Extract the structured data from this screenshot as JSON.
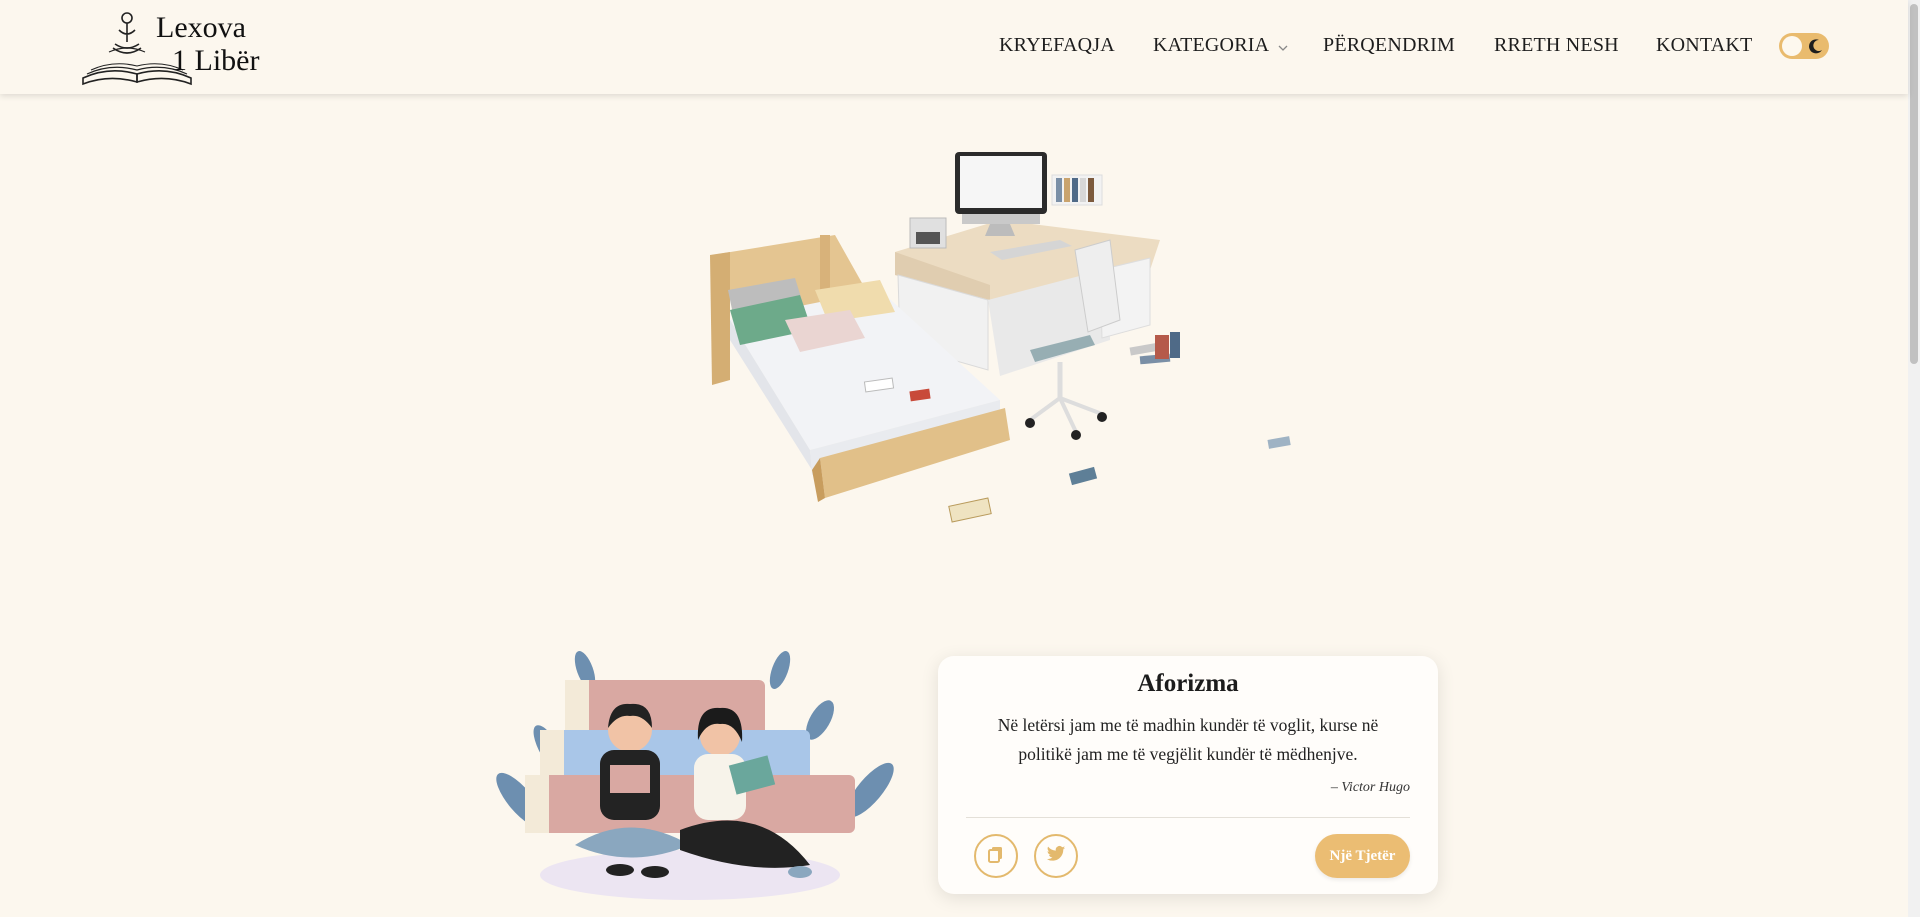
{
  "brand": {
    "logo_line1": "Lexova",
    "logo_line2": "1 Libër"
  },
  "nav": {
    "items": [
      {
        "label": "KRYEFAQJA"
      },
      {
        "label": "KATEGORIA"
      },
      {
        "label": "PËRQENDRIM"
      },
      {
        "label": "RRETH NESH"
      },
      {
        "label": "KONTAKT"
      }
    ],
    "theme_toggle": {
      "icon": "moon-icon",
      "state": "light"
    }
  },
  "colors": {
    "background": "#fcf7ee",
    "accent": "#ebbd73",
    "card": "#fffdfa"
  },
  "quote_card": {
    "title": "Aforizma",
    "text": "Në letërsi jam me të madhin kundër të voglit, kurse në politikë jam me të vegjëlit kundër të mëdhenjve.",
    "author": "– Victor Hugo",
    "copy_icon": "copy-icon",
    "twitter_icon": "twitter-icon",
    "next_label": "Një Tjetër"
  }
}
